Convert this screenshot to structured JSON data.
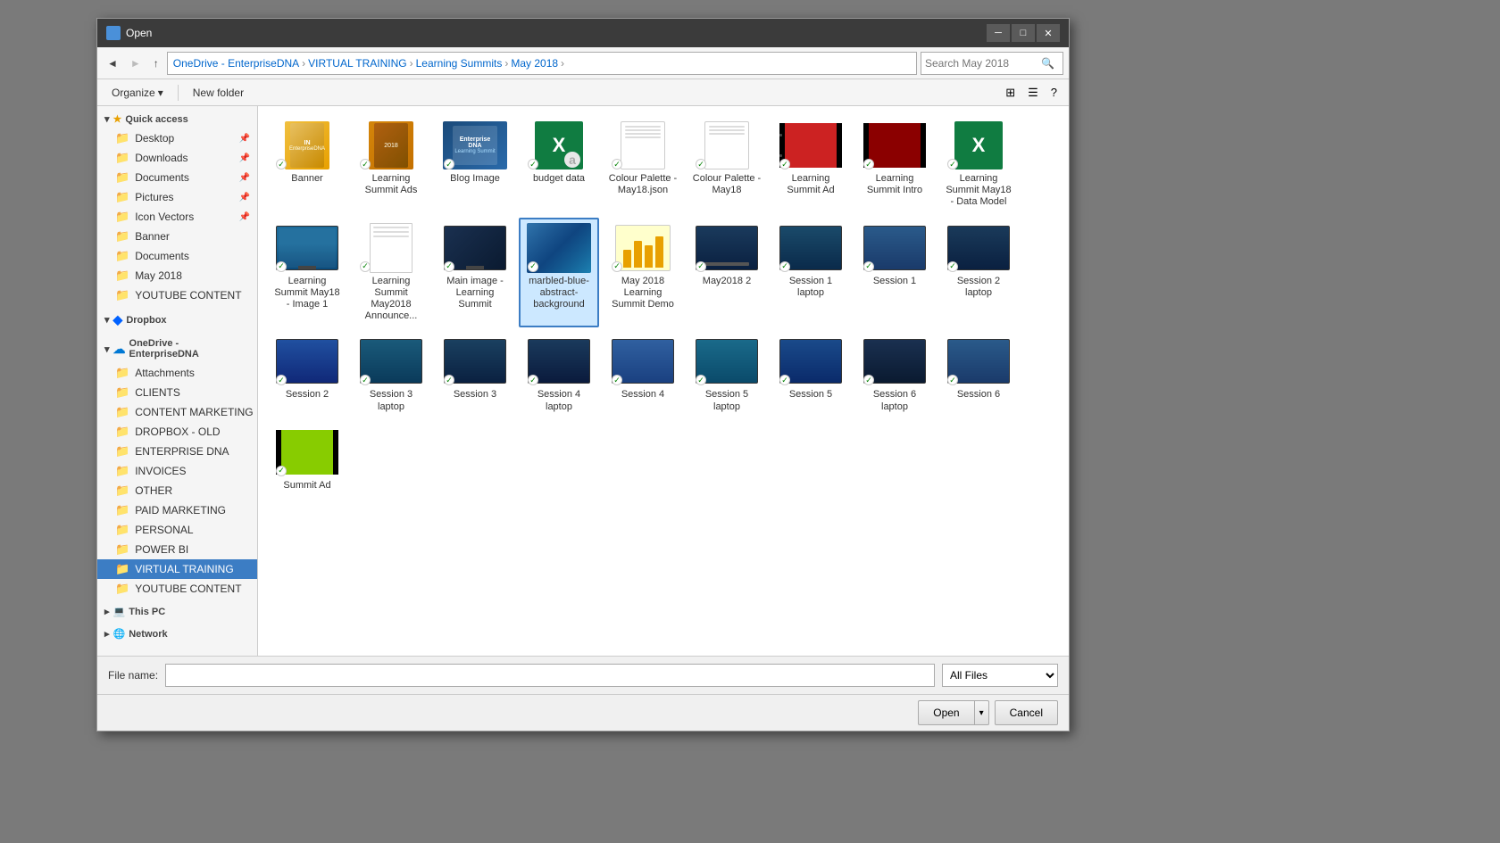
{
  "dialog": {
    "title": "Open",
    "title_icon": "folder-open-icon"
  },
  "address": {
    "breadcrumbs": [
      "OneDrive - EnterpriseDNA",
      "VIRTUAL TRAINING",
      "Learning Summits",
      "May 2018"
    ],
    "search_placeholder": "Search May 2018"
  },
  "toolbar": {
    "organize_label": "Organize",
    "new_folder_label": "New folder"
  },
  "sidebar": {
    "quick_access_label": "Quick access",
    "items_quick": [
      {
        "label": "Desktop",
        "type": "folder",
        "pin": true
      },
      {
        "label": "Downloads",
        "type": "folder",
        "pin": true
      },
      {
        "label": "Documents",
        "type": "folder",
        "pin": true
      },
      {
        "label": "Pictures",
        "type": "folder",
        "pin": true
      },
      {
        "label": "Icon Vectors",
        "type": "folder",
        "pin": true
      },
      {
        "label": "Banner",
        "type": "folder"
      },
      {
        "label": "Documents",
        "type": "folder"
      },
      {
        "label": "May 2018",
        "type": "folder"
      },
      {
        "label": "YOUTUBE CONTENT",
        "type": "folder"
      }
    ],
    "dropbox_label": "Dropbox",
    "onedrive_label": "OneDrive - EnterpriseDNA",
    "items_onedrive": [
      {
        "label": "Attachments",
        "type": "folder"
      },
      {
        "label": "CLIENTS",
        "type": "folder"
      },
      {
        "label": "CONTENT MARKETING",
        "type": "folder"
      },
      {
        "label": "DROPBOX - OLD",
        "type": "folder"
      },
      {
        "label": "ENTERPRISE DNA",
        "type": "folder"
      },
      {
        "label": "INVOICES",
        "type": "folder"
      },
      {
        "label": "OTHER",
        "type": "folder"
      },
      {
        "label": "PAID MARKETING",
        "type": "folder"
      },
      {
        "label": "PERSONAL",
        "type": "folder"
      },
      {
        "label": "POWER BI",
        "type": "folder"
      },
      {
        "label": "VIRTUAL TRAINING",
        "type": "folder",
        "selected": true
      },
      {
        "label": "YOUTUBE CONTENT",
        "type": "folder"
      }
    ],
    "thispc_label": "This PC",
    "network_label": "Network"
  },
  "files": [
    {
      "name": "Banner",
      "type": "book-yellow"
    },
    {
      "name": "Learning Summit Ads",
      "type": "book-brown"
    },
    {
      "name": "Blog Image",
      "type": "dna-cover"
    },
    {
      "name": "budget data",
      "type": "excel"
    },
    {
      "name": "Colour Palette - May18.json",
      "type": "json-doc"
    },
    {
      "name": "Colour Palette - May18",
      "type": "json-doc2"
    },
    {
      "name": "Learning Summit Ad",
      "type": "video-red"
    },
    {
      "name": "Learning Summit Intro",
      "type": "video-darkred"
    },
    {
      "name": "Learning Summit May18 - Data Model",
      "type": "excel2"
    },
    {
      "name": "Learning Summit May18 - Image 1",
      "type": "screen-blue"
    },
    {
      "name": "Learning Summit May2018 Announce...",
      "type": "blank-doc"
    },
    {
      "name": "Main image - Learning Summit",
      "type": "screen-dark"
    },
    {
      "name": "marbled-blue-abstract-background",
      "type": "blue-abs",
      "selected": true
    },
    {
      "name": "May 2018 Learning Summit Demo",
      "type": "chart"
    },
    {
      "name": "May2018 2",
      "type": "screen-dark2"
    },
    {
      "name": "Session 1 laptop",
      "type": "screen-laptop"
    },
    {
      "name": "Session 1",
      "type": "screen-s1"
    },
    {
      "name": "Session 2 laptop",
      "type": "screen-laptop2"
    },
    {
      "name": "Session 2",
      "type": "screen-s2"
    },
    {
      "name": "Session 3 laptop",
      "type": "screen-laptop3"
    },
    {
      "name": "Session 3",
      "type": "screen-s3"
    },
    {
      "name": "Session 4 laptop",
      "type": "screen-laptop4"
    },
    {
      "name": "Session 4",
      "type": "screen-s4"
    },
    {
      "name": "Session 5 laptop",
      "type": "screen-laptop5"
    },
    {
      "name": "Session 5",
      "type": "screen-s5"
    },
    {
      "name": "Session 6 laptop",
      "type": "screen-laptop6"
    },
    {
      "name": "Session 6",
      "type": "screen-s6"
    },
    {
      "name": "Summit Ad",
      "type": "green-film"
    }
  ],
  "bottom": {
    "filename_label": "File name:",
    "filetype_label": "All Files",
    "open_label": "Open",
    "cancel_label": "Cancel"
  }
}
